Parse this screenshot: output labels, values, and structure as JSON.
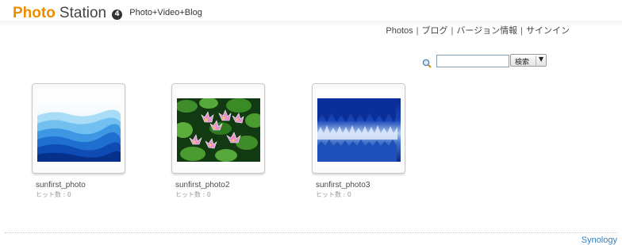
{
  "app": {
    "brand_part1": "Photo",
    "brand_part2": "Station",
    "version_badge": "4",
    "tagline": "Photo+Video+Blog"
  },
  "nav": {
    "photos": "Photos",
    "blog": "ブログ",
    "version_info": "バージョン情報",
    "sign_in": "サインイン",
    "separator": "|"
  },
  "search": {
    "value": "",
    "button_label": "検索",
    "dropdown_glyph": "▼",
    "icon": "magnifier-icon"
  },
  "albums": [
    {
      "title": "sunfirst_photo",
      "hits": "ヒット数 : 0",
      "thumbnail": "blue-mountains"
    },
    {
      "title": "sunfirst_photo2",
      "hits": "ヒット数 : 0",
      "thumbnail": "water-lilies"
    },
    {
      "title": "sunfirst_photo3",
      "hits": "ヒット数 : 0",
      "thumbnail": "blue-forest-mist"
    }
  ],
  "footer": {
    "brand": "Synology"
  },
  "colors": {
    "accent": "#f08c00",
    "link": "#2f7fc0",
    "input_border": "#7f9db9"
  }
}
